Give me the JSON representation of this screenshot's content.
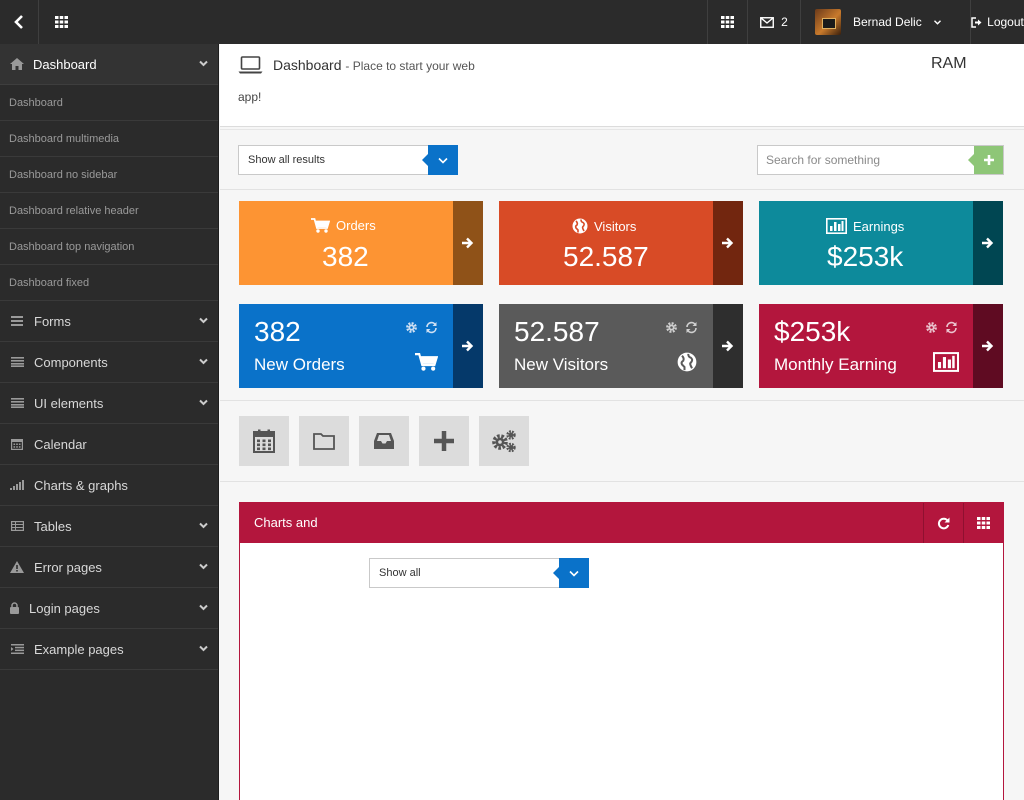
{
  "topbar": {
    "mail_count": "2",
    "user_name": "Bernad Delic",
    "logout_label": "Logout"
  },
  "sidebar": {
    "section": "Dashboard",
    "subitems": [
      "Dashboard",
      "Dashboard multimedia",
      "Dashboard no sidebar",
      "Dashboard relative header",
      "Dashboard top navigation",
      "Dashboard fixed"
    ],
    "items": [
      {
        "label": "Forms",
        "icon": "forms-icon",
        "chevron": true
      },
      {
        "label": "Components",
        "icon": "components-icon",
        "chevron": true
      },
      {
        "label": "UI elements",
        "icon": "ui-elements-icon",
        "chevron": true
      },
      {
        "label": "Calendar",
        "icon": "calendar-icon",
        "chevron": false
      },
      {
        "label": "Charts & graphs",
        "icon": "charts-icon",
        "chevron": false
      },
      {
        "label": "Tables",
        "icon": "tables-icon",
        "chevron": true
      },
      {
        "label": "Error pages",
        "icon": "warning-icon",
        "chevron": true
      },
      {
        "label": "Login pages",
        "icon": "lock-icon",
        "chevron": true
      },
      {
        "label": "Example pages",
        "icon": "list-icon",
        "chevron": true
      }
    ]
  },
  "page": {
    "title": "Dashboard",
    "subtitle": "- Place to start your web",
    "subtitle_wrap": "app!",
    "ram": "RAM"
  },
  "toolbar": {
    "select_value": "Show all results",
    "search_placeholder": "Search for something"
  },
  "tiles_row1": [
    {
      "label": "Orders",
      "value": "382",
      "icon": "cart-icon",
      "color": "#fd9433",
      "side": "#8f5218"
    },
    {
      "label": "Visitors",
      "value": "52.587",
      "icon": "globe-icon",
      "color": "#d84b26",
      "side": "#72260f"
    },
    {
      "label": "Earnings",
      "value": "$253k",
      "icon": "bar-chart-icon",
      "color": "#0d8a9b",
      "side": "#004652"
    }
  ],
  "tiles_row2": [
    {
      "value": "382",
      "label": "New Orders",
      "icon": "cart-icon",
      "color": "#0a72c9",
      "side": "#05396a"
    },
    {
      "value": "52.587",
      "label": "New Visitors",
      "icon": "globe-icon",
      "color": "#5a5a5a",
      "side": "#2e2e2e"
    },
    {
      "value": "$253k",
      "label": "Monthly Earning",
      "icon": "bar-chart-icon",
      "color": "#b3163d",
      "side": "#5f0b22"
    }
  ],
  "quick_buttons": [
    "calendar-icon",
    "folder-icon",
    "inbox-icon",
    "plus-icon",
    "gears-icon"
  ],
  "panel": {
    "title": "Charts and",
    "select_value": "Show all"
  },
  "colors": {
    "topbar": "#2b2b2b",
    "accent_blue": "#0a72c9",
    "accent_green": "#8ec677",
    "panel_red": "#b3163d"
  }
}
